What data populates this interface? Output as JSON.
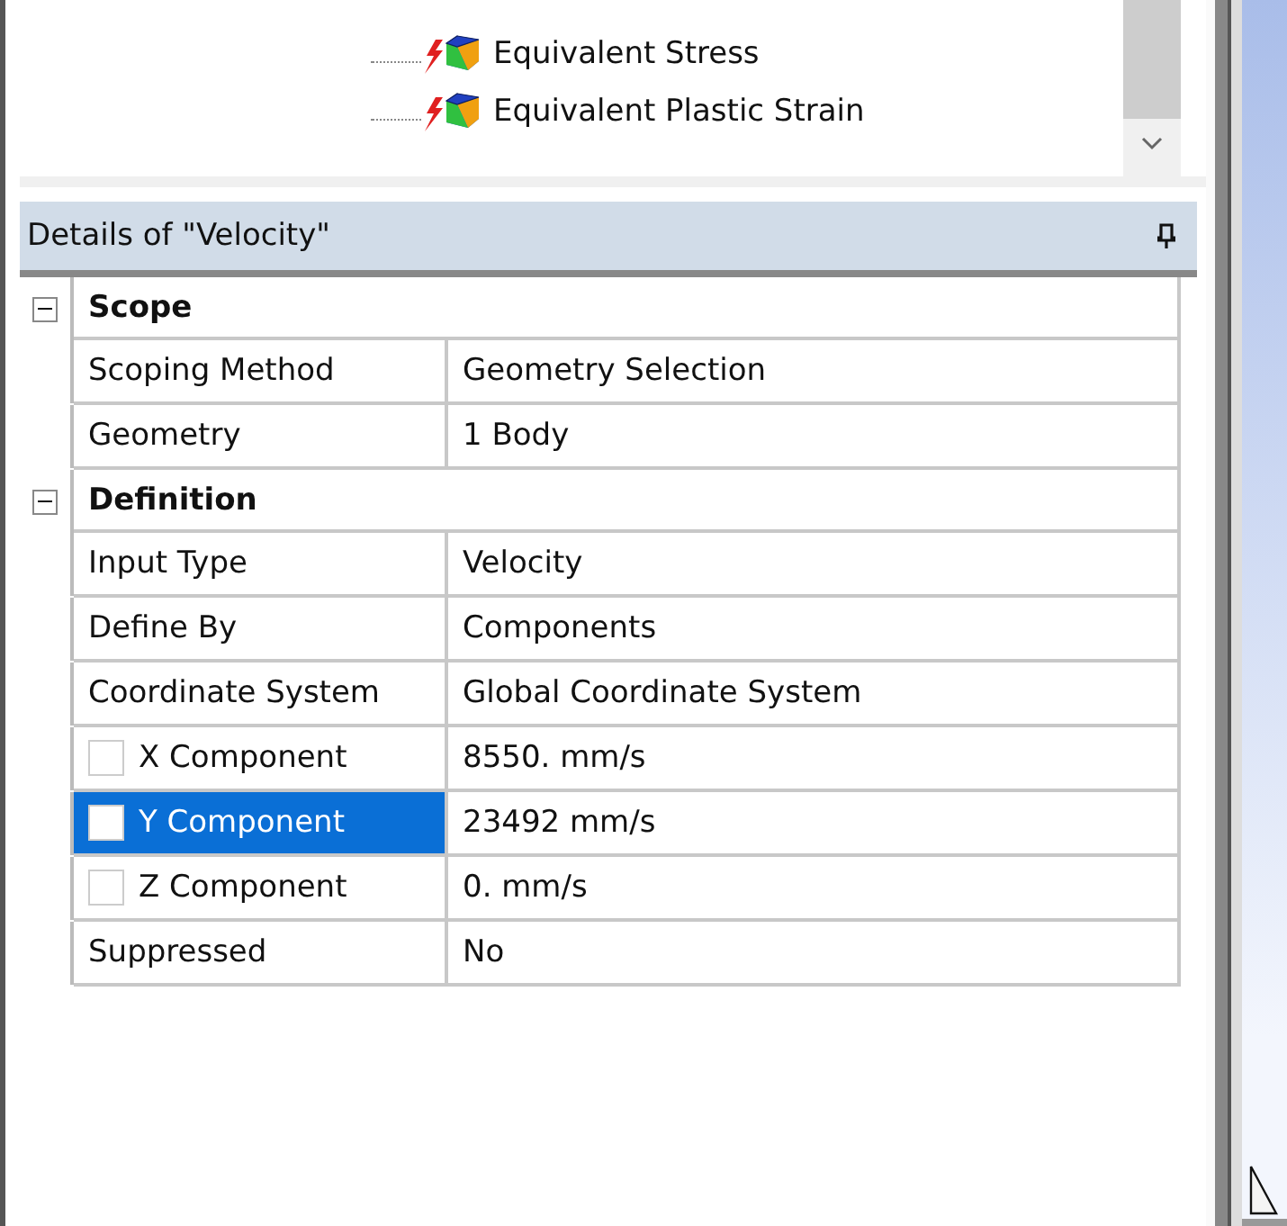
{
  "tree": {
    "items": [
      {
        "label": "Equivalent Stress"
      },
      {
        "label": "Equivalent Plastic Strain"
      }
    ]
  },
  "details": {
    "title": "Details of \"Velocity\"",
    "groups": [
      {
        "name": "Scope",
        "expanded": true,
        "rows": [
          {
            "kind": "plain",
            "label": "Scoping Method",
            "value": "Geometry Selection",
            "selected": false
          },
          {
            "kind": "plain",
            "label": "Geometry",
            "value": "1 Body",
            "selected": false
          }
        ]
      },
      {
        "name": "Definition",
        "expanded": true,
        "rows": [
          {
            "kind": "plain",
            "label": "Input Type",
            "value": "Velocity",
            "selected": false
          },
          {
            "kind": "plain",
            "label": "Define By",
            "value": "Components",
            "selected": false
          },
          {
            "kind": "plain",
            "label": "Coordinate System",
            "value": "Global Coordinate System",
            "selected": false
          },
          {
            "kind": "checkbox",
            "label": "X Component",
            "value": "8550. mm/s",
            "selected": false,
            "checked": false
          },
          {
            "kind": "checkbox",
            "label": "Y Component",
            "value": "23492 mm/s",
            "selected": true,
            "checked": false
          },
          {
            "kind": "checkbox",
            "label": "Z Component",
            "value": "0. mm/s",
            "selected": false,
            "checked": false
          },
          {
            "kind": "plain",
            "label": "Suppressed",
            "value": "No",
            "selected": false
          }
        ]
      }
    ]
  }
}
